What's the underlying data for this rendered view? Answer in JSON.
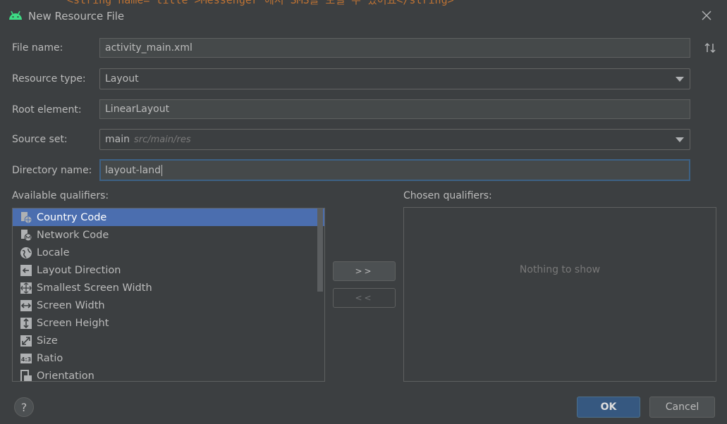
{
  "window": {
    "title": "New Resource File",
    "background_code": "<string name=\"title\">Messenger 에서 SMS를 보낼 수 있어요</string>"
  },
  "form": {
    "file_name": {
      "label": "File name:",
      "value": "activity_main.xml"
    },
    "resource_type": {
      "label": "Resource type:",
      "value": "Layout"
    },
    "root_element": {
      "label": "Root element:",
      "value": "LinearLayout"
    },
    "source_set": {
      "label": "Source set:",
      "value": "main",
      "hint": "src/main/res"
    },
    "directory_name": {
      "label": "Directory name:",
      "value": "layout-land"
    }
  },
  "available": {
    "label": "Available qualifiers:",
    "items": [
      {
        "label": "Country Code",
        "icon": "country-code-icon",
        "selected": true
      },
      {
        "label": "Network Code",
        "icon": "network-code-icon"
      },
      {
        "label": "Locale",
        "icon": "globe-icon"
      },
      {
        "label": "Layout Direction",
        "icon": "layout-direction-icon"
      },
      {
        "label": "Smallest Screen Width",
        "icon": "smallest-width-icon"
      },
      {
        "label": "Screen Width",
        "icon": "screen-width-icon"
      },
      {
        "label": "Screen Height",
        "icon": "screen-height-icon"
      },
      {
        "label": "Size",
        "icon": "size-icon"
      },
      {
        "label": "Ratio",
        "icon": "ratio-icon"
      },
      {
        "label": "Orientation",
        "icon": "orientation-icon"
      }
    ]
  },
  "move": {
    "add_label": ">>",
    "remove_label": "<<"
  },
  "chosen": {
    "label": "Chosen qualifiers:",
    "empty_text": "Nothing to show"
  },
  "footer": {
    "help_label": "?",
    "ok_label": "OK",
    "cancel_label": "Cancel"
  },
  "colors": {
    "background": "#3c3f41",
    "selection": "#4b6eaf",
    "focus_border": "#3d6185",
    "primary_button": "#365880",
    "android_green": "#3ddc84"
  }
}
